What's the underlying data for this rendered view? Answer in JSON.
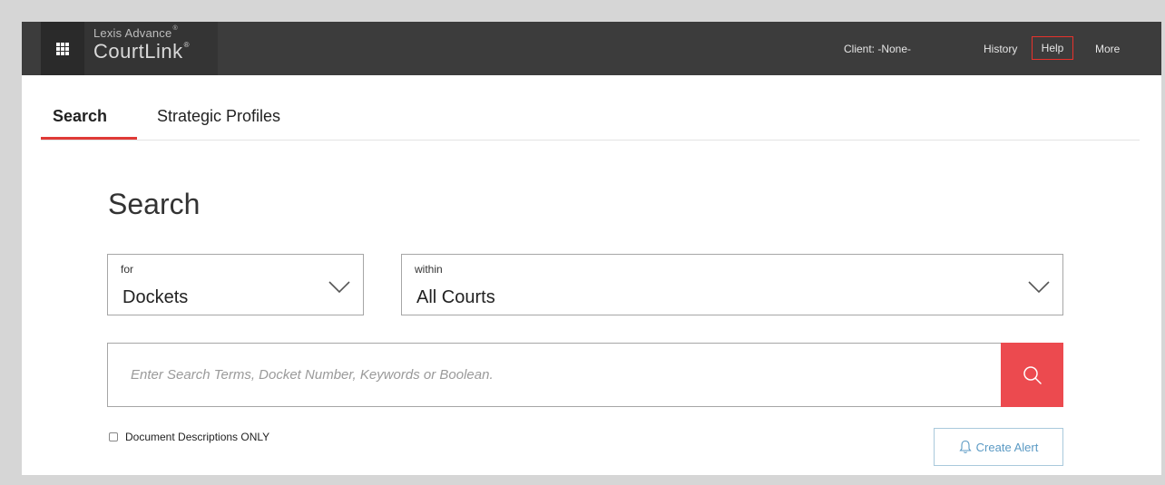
{
  "header": {
    "brand_small": "Lexis Advance",
    "brand_large": "CourtLink",
    "brand_mark": "®",
    "nav": {
      "client": "Client: -None-",
      "history": "History",
      "help": "Help",
      "more": "More"
    },
    "apps_icon": "grid-icon"
  },
  "tabs": [
    {
      "label": "Search",
      "active": true
    },
    {
      "label": "Strategic Profiles",
      "active": false
    }
  ],
  "main": {
    "title": "Search",
    "for_select": {
      "label": "for",
      "value": "Dockets"
    },
    "within_select": {
      "label": "within",
      "value": "All Courts"
    },
    "search": {
      "placeholder": "Enter Search Terms, Docket Number, Keywords or Boolean.",
      "value": "",
      "button_icon": "search-icon"
    },
    "checkbox_label": "Document Descriptions ONLY",
    "checkbox_checked": false,
    "alert_button": "Create Alert",
    "alert_icon": "bell-icon"
  },
  "colors": {
    "topbar": "#3c3c3c",
    "accent_red": "#ec4a4f",
    "help_outline": "#e8322c",
    "link_blue": "#5b9ac4"
  }
}
